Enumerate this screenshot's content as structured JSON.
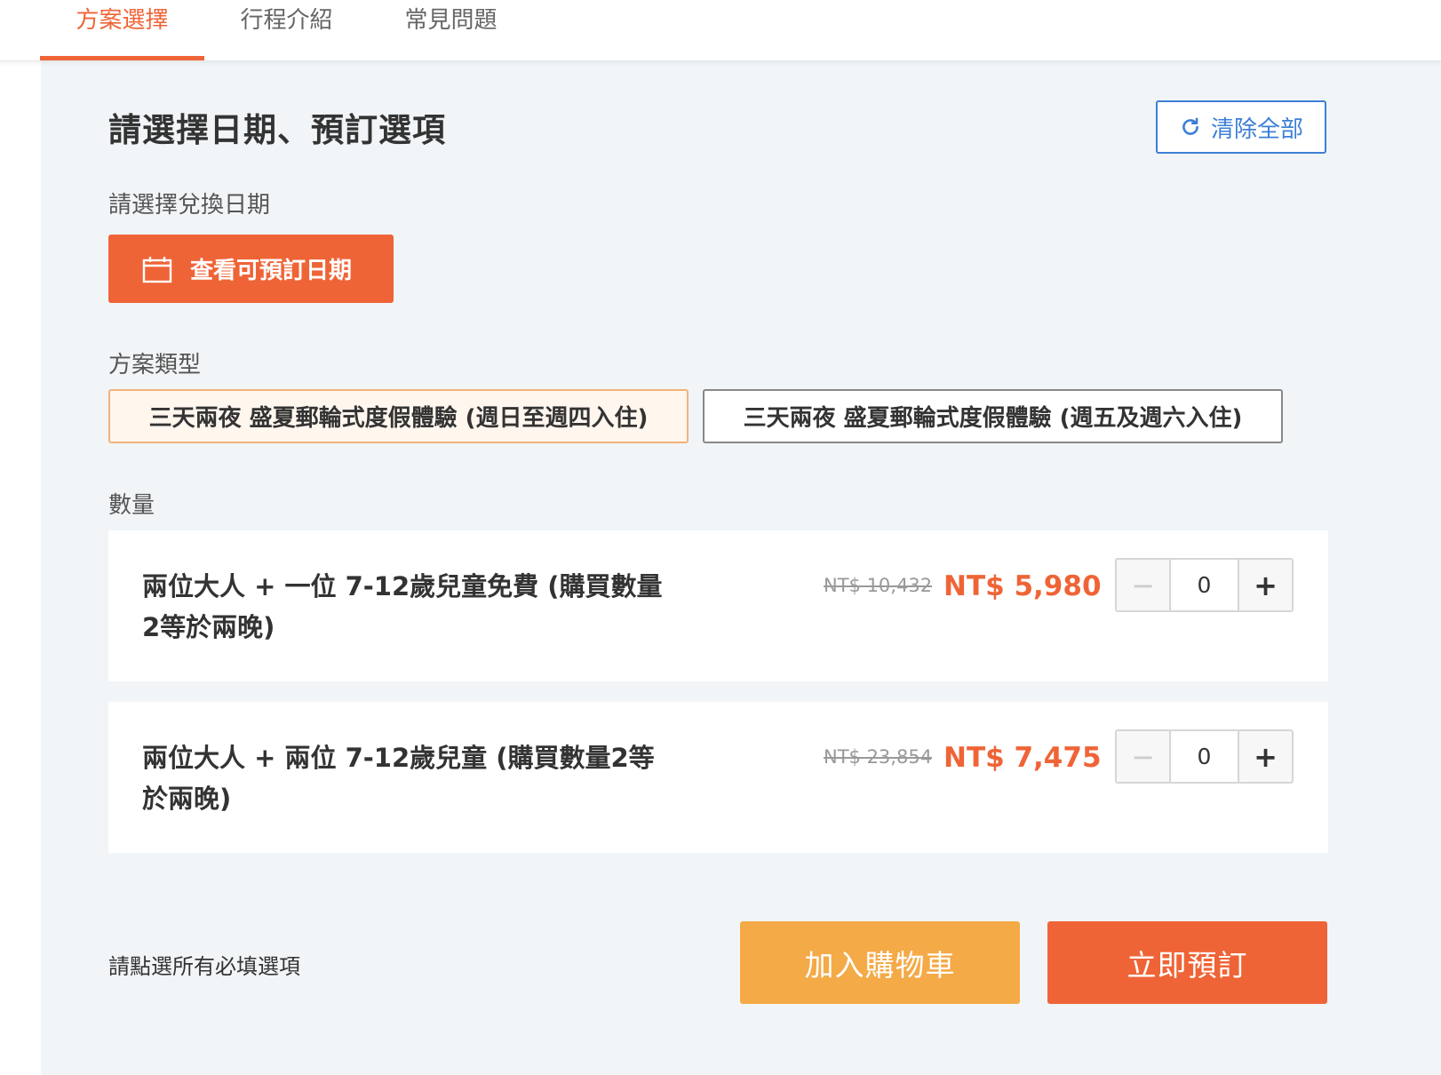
{
  "tabs": [
    {
      "label": "方案選擇",
      "active": true
    },
    {
      "label": "行程介紹",
      "active": false
    },
    {
      "label": "常見問題",
      "active": false
    }
  ],
  "header": {
    "title": "請選擇日期、預訂選項",
    "clear_label": "清除全部",
    "clear_icon": "refresh-icon"
  },
  "date_section": {
    "label": "請選擇兌換日期",
    "button_label": "查看可預訂日期",
    "button_icon": "calendar-icon"
  },
  "plan_section": {
    "label": "方案類型",
    "options": [
      {
        "label": "三天兩夜 盛夏郵輪式度假體驗 (週日至週四入住)",
        "selected": true
      },
      {
        "label": "三天兩夜 盛夏郵輪式度假體驗 (週五及週六入住)",
        "selected": false
      }
    ]
  },
  "quantity_section": {
    "label": "數量",
    "items": [
      {
        "title": "兩位大人 + 一位 7-12歲兒童免費 (購買數量2等於兩晚)",
        "old_price": "NT$ 10,432",
        "price": "NT$ 5,980",
        "quantity": "0"
      },
      {
        "title": "兩位大人 + 兩位 7-12歲兒童 (購買數量2等於兩晚)",
        "old_price": "NT$ 23,854",
        "price": "NT$ 7,475",
        "quantity": "0"
      }
    ],
    "minus_symbol": "−",
    "plus_symbol": "+"
  },
  "footer": {
    "hint": "請點選所有必填選項",
    "add_to_cart_label": "加入購物車",
    "book_now_label": "立即預訂"
  },
  "colors": {
    "accent": "#ef6437",
    "cart": "#f4aa47",
    "link_blue": "#3d7fd6",
    "panel_bg": "#f1f5f7"
  }
}
